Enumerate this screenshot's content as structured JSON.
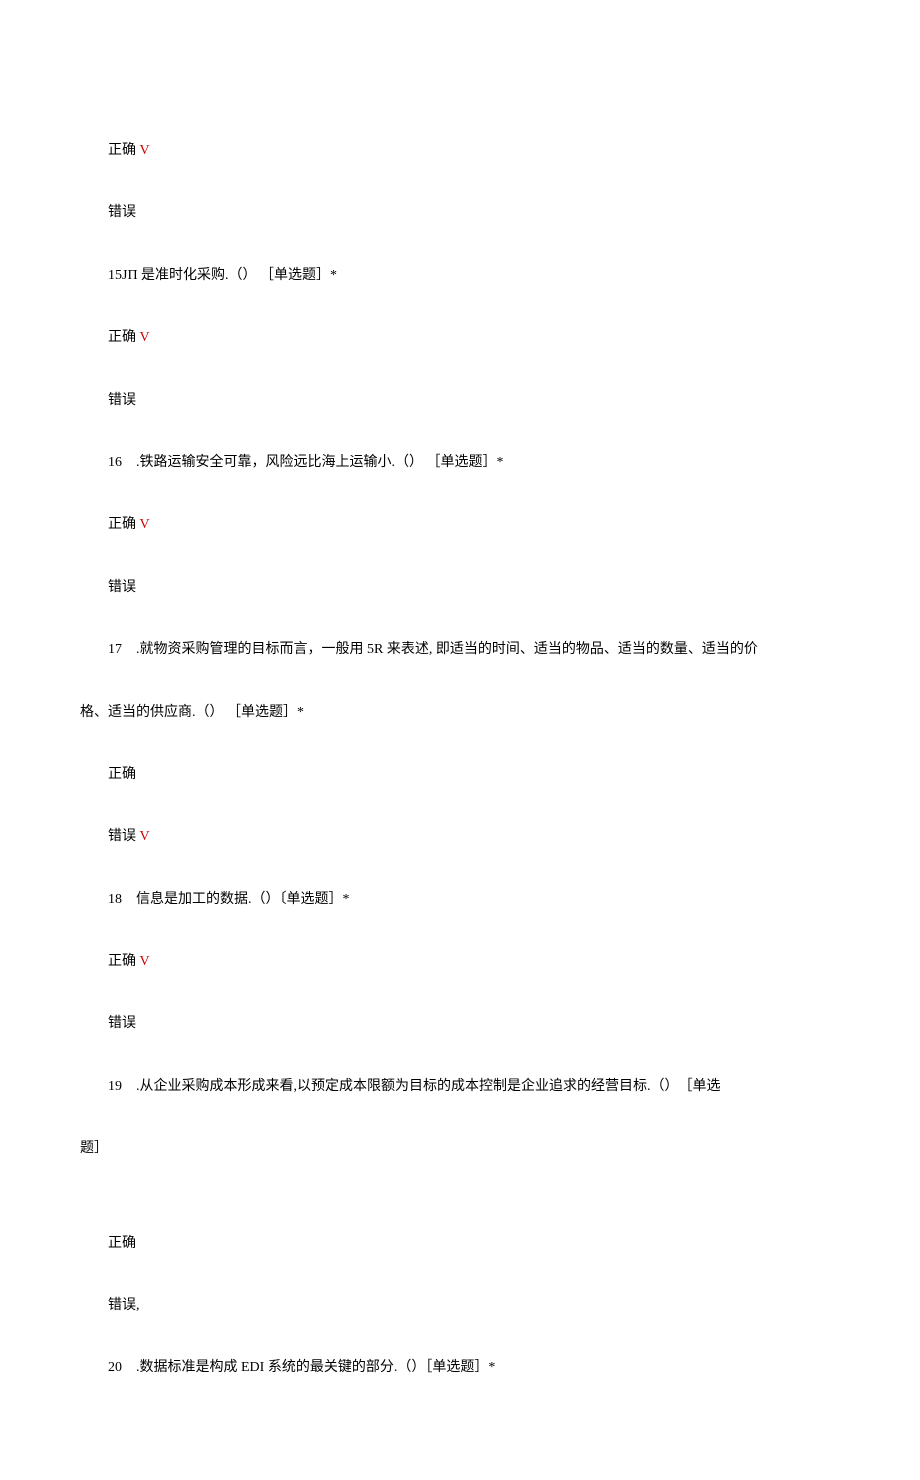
{
  "lines": {
    "l1_correct": "正确",
    "check": " V",
    "l2_wrong": "错误",
    "q15": "15JΠ 是准时化采购.（） ［单选题］*",
    "l3_correct": "正确",
    "l4_wrong": "错误",
    "q16": "16　.铁路运输安全可靠，风险远比海上运输小.（） ［单选题］*",
    "l5_correct": "正确",
    "l6_wrong": "错误",
    "q17_p1": "17　.就物资采购管理的目标而言，一般用 5R 来表述, 即适当的时间、适当的物品、适当的数量、适当的价",
    "q17_p2": "格、适当的供应商.（） ［单选题］*",
    "l7_correct": "正确",
    "l8_wrong": "错误",
    "q18": "18　信息是加工的数据.（）〔单选题］*",
    "l9_correct": "正确",
    "l10_wrong": "错误",
    "q19_p1": "19　.从企业采购成本形成来看,以预定成本限额为目标的成本控制是企业追求的经营目标.（）　［单选",
    "q19_p2": "题］",
    "l11_correct": "正确",
    "l12_wrong": "错误,",
    "q20": "20　.数据标准是构成 EDI 系统的最关键的部分.（）［单选题］*"
  }
}
